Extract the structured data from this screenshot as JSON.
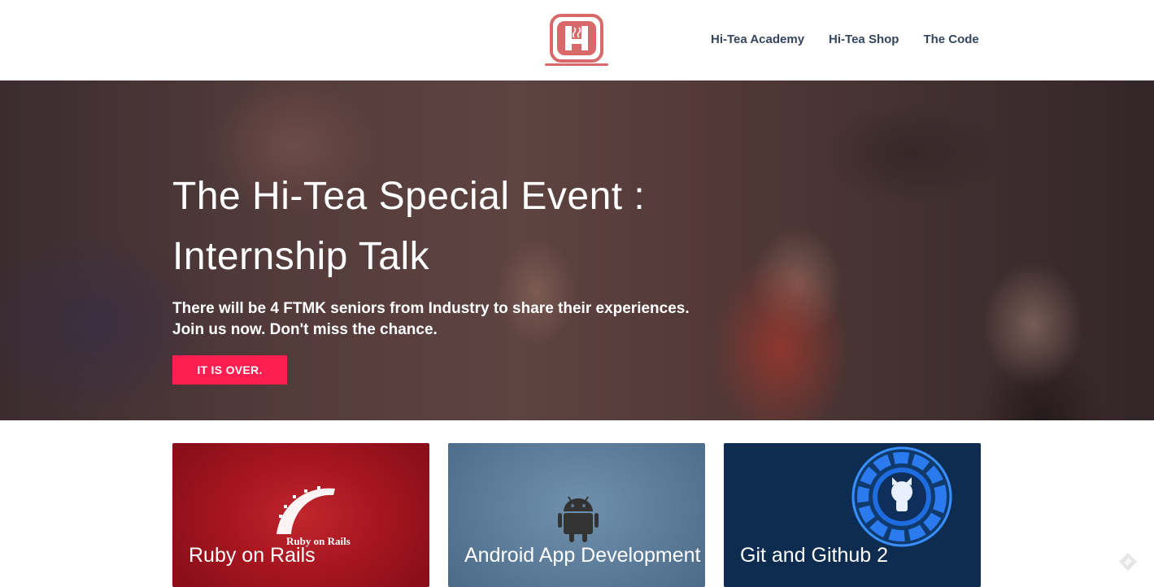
{
  "header": {
    "nav": [
      {
        "label": "Hi-Tea Academy"
      },
      {
        "label": "Hi-Tea Shop"
      },
      {
        "label": "The Code"
      }
    ]
  },
  "hero": {
    "title_line1": "The Hi-Tea Special Event :",
    "title_line2": "Internship Talk",
    "text_line1": "There will be 4 FTMK seniors from Industry to share their experiences.",
    "text_line2": "Join us now. Don't miss the chance.",
    "button_label": "IT IS OVER."
  },
  "cards": [
    {
      "title": "Ruby on Rails",
      "logo_text": "Ruby on Rails",
      "icon": "ruby-on-rails-logo"
    },
    {
      "title": "Android App Development",
      "icon": "android-icon"
    },
    {
      "title": "Git and Github 2",
      "icon": "github-octocat-icon"
    }
  ],
  "colors": {
    "nav_text": "#35465c",
    "button": "#ff1e50",
    "logo": "#d9686a",
    "ruby_card": "#a5151f",
    "android_card": "#5a7a98",
    "git_card": "#0d2c4f"
  }
}
